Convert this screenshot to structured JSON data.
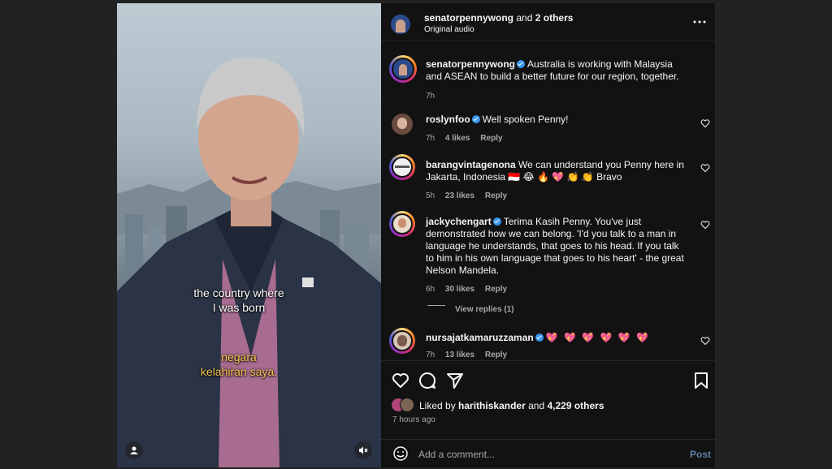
{
  "header": {
    "username": "senatorpennywong",
    "and_text": "and",
    "others": "2 others",
    "audio": "Original audio",
    "more_icon": "more-horizontal-icon"
  },
  "video": {
    "caption_en_line1": "the country where",
    "caption_en_line2": "I was born",
    "caption_id_line1": "negara",
    "caption_id_line2": "kelahiran saya.",
    "user_icon": "user-tag-icon",
    "mute_icon": "muted-speaker-icon"
  },
  "post": {
    "username": "senatorpennywong",
    "text": "Australia is working with Malaysia and ASEAN to build a better future for our region, together.",
    "time": "7h"
  },
  "comments": [
    {
      "username": "roslynfoo",
      "verified": true,
      "text": "Well spoken Penny!",
      "time": "7h",
      "likes": "4 likes",
      "reply": "Reply"
    },
    {
      "username": "barangvintagenona",
      "verified": false,
      "text": "We can understand you Penny here in Jakarta, Indonesia 🇮🇩 😂 🔥 💖 👏 👏 Bravo",
      "time": "5h",
      "likes": "23 likes",
      "reply": "Reply"
    },
    {
      "username": "jackychengart",
      "verified": true,
      "text": "Terima Kasih Penny. You've just demonstrated how we can belong. 'I'd you talk to a man in language he understands, that goes to his head. If you talk to him in his own language that goes to his heart' - the great Nelson Mandela.",
      "time": "6h",
      "likes": "30 likes",
      "reply": "Reply",
      "view_replies": "View replies (1)"
    },
    {
      "username": "nursajatkamaruzzaman",
      "verified": true,
      "text": "💖 💖 💖 💖 💖 💖",
      "time": "7h",
      "likes": "13 likes",
      "reply": "Reply"
    }
  ],
  "actions": {
    "like_icon": "heart-icon",
    "comment_icon": "comment-icon",
    "share_icon": "send-icon",
    "save_icon": "bookmark-icon",
    "liked_by_prefix": "Liked by",
    "liked_by_user": "harithiskander",
    "liked_by_and": "and",
    "liked_by_count": "4,229 others",
    "posted_ago": "7 hours ago"
  },
  "add_comment": {
    "emoji_icon": "emoji-icon",
    "placeholder": "Add a comment...",
    "post_label": "Post"
  },
  "colors": {
    "page_bg": "#222222",
    "panel_bg": "#121212",
    "verified": "#3897f0",
    "post_button": "#5e7fa8",
    "caption_secondary": "#f5c451"
  }
}
